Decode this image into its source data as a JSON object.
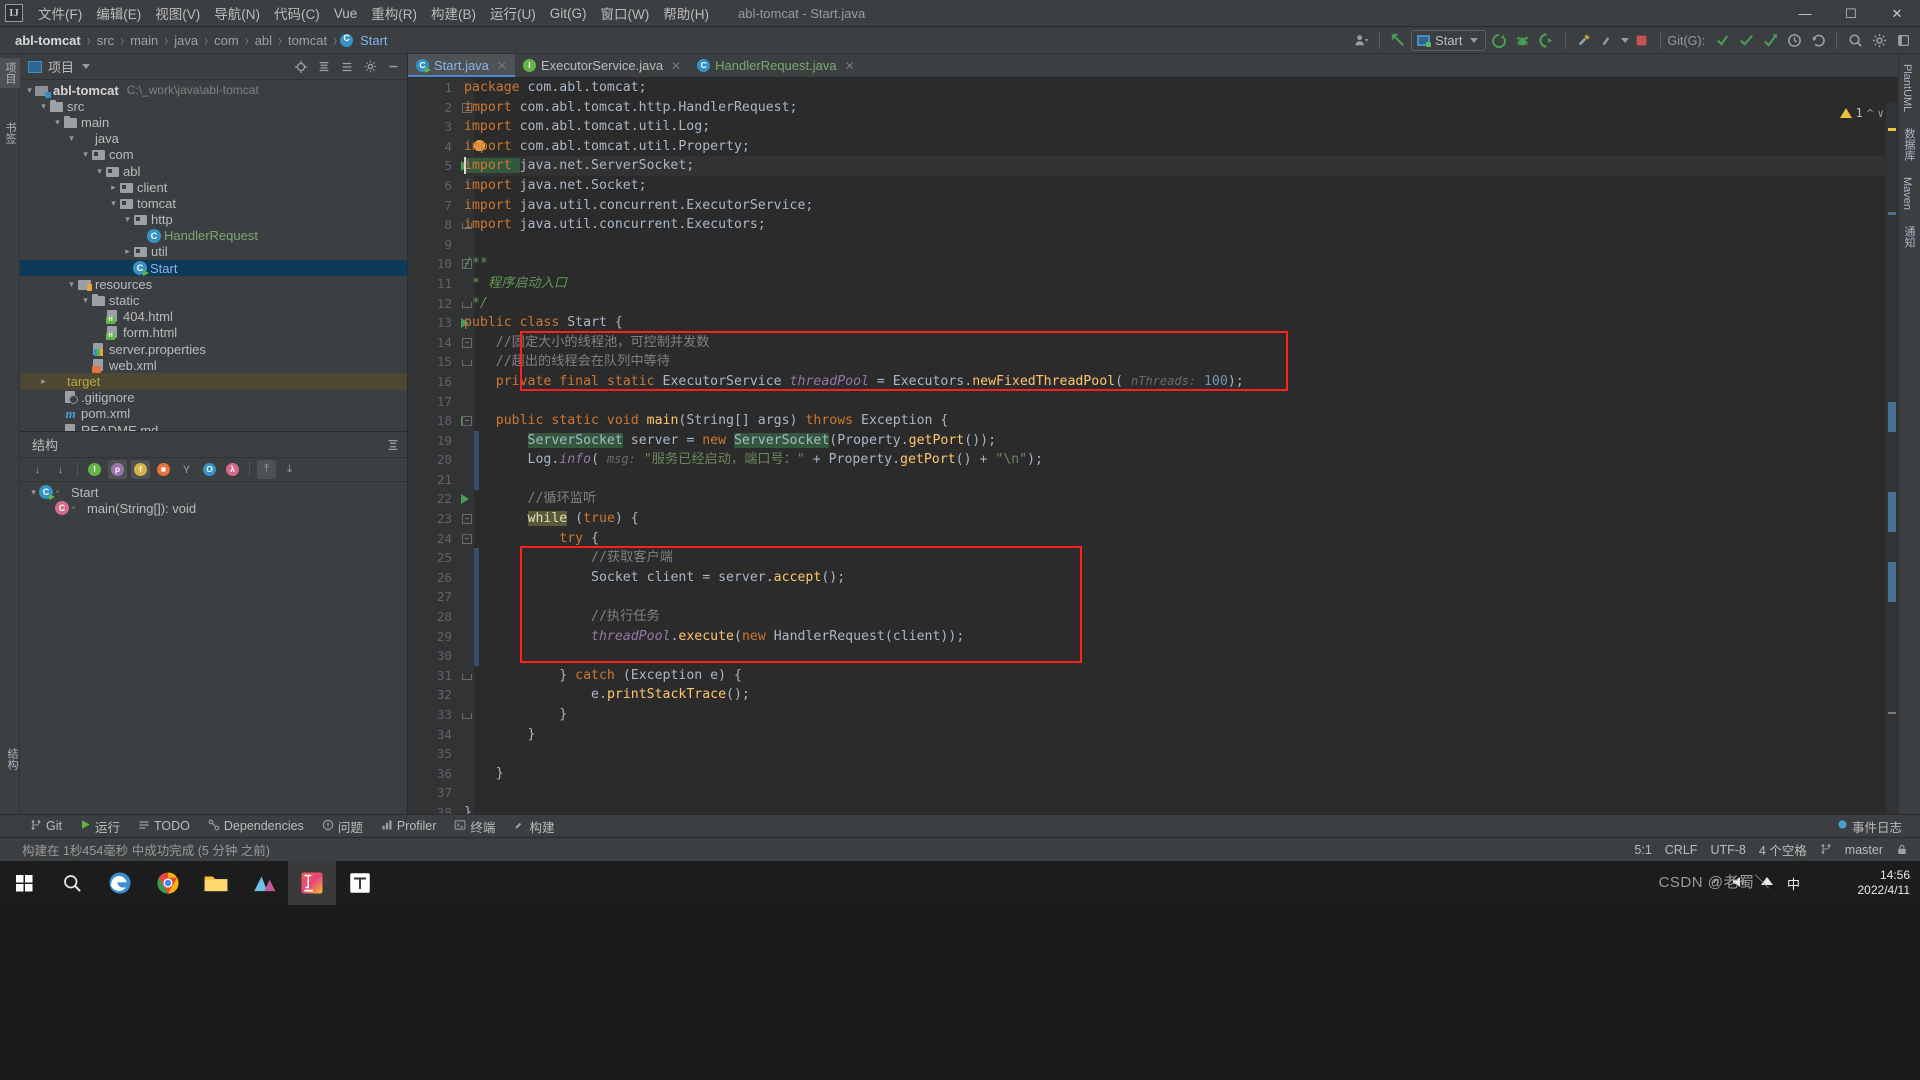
{
  "window": {
    "title": "abl-tomcat - Start.java",
    "controls": {
      "minimize": "—",
      "maximize": "☐",
      "close": "✕"
    }
  },
  "menu": {
    "items": [
      {
        "label": "文件(F)"
      },
      {
        "label": "编辑(E)"
      },
      {
        "label": "视图(V)"
      },
      {
        "label": "导航(N)"
      },
      {
        "label": "代码(C)"
      },
      {
        "label": "Vue"
      },
      {
        "label": "重构(R)"
      },
      {
        "label": "构建(B)"
      },
      {
        "label": "运行(U)"
      },
      {
        "label": "Git(G)"
      },
      {
        "label": "窗口(W)"
      },
      {
        "label": "帮助(H)"
      }
    ]
  },
  "breadcrumb": {
    "items": [
      "abl-tomcat",
      "src",
      "main",
      "java",
      "com",
      "abl",
      "tomcat",
      "Start"
    ],
    "separator": "›"
  },
  "toolbar": {
    "run_config": "Start",
    "git_label": "Git(G):",
    "profile_icon": "profile-icon",
    "back_icon": "back-arrow-icon",
    "rerun_icon": "rerun-icon",
    "debug_icon": "debug-icon",
    "run_with_coverage_icon": "run-coverage-icon",
    "build_icon": "build-icon",
    "stop_icon": "stop-icon",
    "update_project_icon": "update-project-icon",
    "commit_icon": "commit-icon",
    "push_icon": "push-icon",
    "history_icon": "history-icon",
    "rollback_icon": "rollback-icon",
    "search_icon": "search-everywhere-icon",
    "settings_icon": "settings-icon",
    "minimize_panel_icon": "minimize-icon"
  },
  "project_panel": {
    "title": "项目",
    "tools": [
      "locate-icon",
      "collapse-all-icon",
      "expand-icon",
      "settings-icon",
      "hide-icon"
    ],
    "tree": [
      {
        "depth": 0,
        "arrow": "⌄",
        "icon": "module",
        "label": "abl-tomcat",
        "path": "C:\\_work\\java\\abl-tomcat",
        "style": "root"
      },
      {
        "depth": 1,
        "arrow": "⌄",
        "icon": "folder",
        "label": "src",
        "path": "",
        "style": ""
      },
      {
        "depth": 2,
        "arrow": "⌄",
        "icon": "folder",
        "label": "main",
        "path": "",
        "style": ""
      },
      {
        "depth": 3,
        "arrow": "⌄",
        "icon": "folder-blue",
        "label": "java",
        "path": "",
        "style": ""
      },
      {
        "depth": 4,
        "arrow": "⌄",
        "icon": "package",
        "label": "com",
        "path": "",
        "style": ""
      },
      {
        "depth": 5,
        "arrow": "⌄",
        "icon": "package",
        "label": "abl",
        "path": "",
        "style": ""
      },
      {
        "depth": 6,
        "arrow": "›",
        "icon": "package",
        "label": "client",
        "path": "",
        "style": ""
      },
      {
        "depth": 6,
        "arrow": "⌄",
        "icon": "package",
        "label": "tomcat",
        "path": "",
        "style": ""
      },
      {
        "depth": 7,
        "arrow": "⌄",
        "icon": "package",
        "label": "http",
        "path": "",
        "style": ""
      },
      {
        "depth": 8,
        "arrow": "",
        "icon": "class",
        "label": "HandlerRequest",
        "path": "",
        "style": "green"
      },
      {
        "depth": 7,
        "arrow": "›",
        "icon": "package",
        "label": "util",
        "path": "",
        "style": ""
      },
      {
        "depth": 7,
        "arrow": "",
        "icon": "class-run",
        "label": "Start",
        "path": "",
        "style": "selected"
      },
      {
        "depth": 3,
        "arrow": "⌄",
        "icon": "resources",
        "label": "resources",
        "path": "",
        "style": ""
      },
      {
        "depth": 4,
        "arrow": "⌄",
        "icon": "folder",
        "label": "static",
        "path": "",
        "style": ""
      },
      {
        "depth": 5,
        "arrow": "",
        "icon": "html",
        "label": "404.html",
        "path": "",
        "style": ""
      },
      {
        "depth": 5,
        "arrow": "",
        "icon": "html",
        "label": "form.html",
        "path": "",
        "style": ""
      },
      {
        "depth": 4,
        "arrow": "",
        "icon": "properties",
        "label": "server.properties",
        "path": "",
        "style": ""
      },
      {
        "depth": 4,
        "arrow": "",
        "icon": "xml",
        "label": "web.xml",
        "path": "",
        "style": ""
      },
      {
        "depth": 1,
        "arrow": "›",
        "icon": "folder-orange",
        "label": "target",
        "path": "",
        "style": "target"
      },
      {
        "depth": 2,
        "arrow": "",
        "icon": "gitignore",
        "label": ".gitignore",
        "path": "",
        "style": ""
      },
      {
        "depth": 2,
        "arrow": "",
        "icon": "maven",
        "label": "pom.xml",
        "path": "",
        "style": ""
      },
      {
        "depth": 2,
        "arrow": "",
        "icon": "markdown",
        "label": "README.md",
        "path": "",
        "style": ""
      }
    ]
  },
  "structure_panel": {
    "title": "结构",
    "tools": [
      {
        "name": "sort-by-visibility-icon",
        "glyph": "↓",
        "badge": "",
        "on": false
      },
      {
        "name": "sort-alphabetically-icon",
        "glyph": "↓",
        "badge": "",
        "on": false
      },
      {
        "name": "show-inherited-icon",
        "glyph": "I",
        "badge": "#62b543",
        "on": false
      },
      {
        "name": "show-properties-icon",
        "glyph": "p",
        "badge": "#9876aa",
        "on": true
      },
      {
        "name": "show-fields-icon",
        "glyph": "f",
        "badge": "#d9b24a",
        "on": true
      },
      {
        "name": "show-non-public-icon",
        "glyph": "■",
        "badge": "#e8733d",
        "on": false
      },
      {
        "name": "show-anonymous-icon",
        "glyph": "Y",
        "badge": "",
        "on": false
      },
      {
        "name": "show-interfaces-icon",
        "glyph": "O",
        "badge": "#3592c4",
        "on": false
      },
      {
        "name": "show-lambdas-icon",
        "glyph": "λ",
        "badge": "#d46a8a",
        "on": false
      },
      {
        "name": "expand-all-icon",
        "glyph": "⤒",
        "badge": "",
        "on": true
      },
      {
        "name": "collapse-all-icon",
        "glyph": "⤓",
        "badge": "",
        "on": false
      }
    ],
    "tree": [
      {
        "depth": 0,
        "arrow": "⌄",
        "kind": "class",
        "label": "Start"
      },
      {
        "depth": 1,
        "arrow": "",
        "kind": "method",
        "label": "main(String[]): void"
      }
    ]
  },
  "editor": {
    "tabs": [
      {
        "label": "Start.java",
        "icon": "class-run",
        "active": true,
        "color": "blue"
      },
      {
        "label": "ExecutorService.java",
        "icon": "interface",
        "active": false,
        "color": "plain"
      },
      {
        "label": "HandlerRequest.java",
        "icon": "class",
        "active": false,
        "color": "green"
      }
    ],
    "warning_count": "1",
    "caret_position": "5:1",
    "lines": [
      {
        "n": "1",
        "tokens": [
          {
            "t": "package ",
            "c": "kw"
          },
          {
            "t": "com.abl.tomcat;",
            "c": "pln"
          }
        ]
      },
      {
        "n": "2",
        "fold": "minus",
        "tokens": [
          {
            "t": "import ",
            "c": "kw"
          },
          {
            "t": "com.abl.tomcat.http.HandlerRequest;",
            "c": "pln"
          }
        ]
      },
      {
        "n": "3",
        "tokens": [
          {
            "t": "import ",
            "c": "kw"
          },
          {
            "t": "com.abl.tomcat.util.Log;",
            "c": "pln"
          }
        ]
      },
      {
        "n": "4",
        "bulb": true,
        "tokens": [
          {
            "t": "import ",
            "c": "kw"
          },
          {
            "t": "com.abl.tomcat.util.Property;",
            "c": "pln"
          }
        ]
      },
      {
        "n": "5",
        "caret": true,
        "run": true,
        "tokens": [
          {
            "t": "import ",
            "c": "kw warnbg"
          },
          {
            "t": "java.net.ServerSocket;",
            "c": "pln"
          }
        ]
      },
      {
        "n": "6",
        "tokens": [
          {
            "t": "import ",
            "c": "kw"
          },
          {
            "t": "java.net.Socket;",
            "c": "pln"
          }
        ]
      },
      {
        "n": "7",
        "tokens": [
          {
            "t": "import ",
            "c": "kw"
          },
          {
            "t": "java.util.concurrent.ExecutorService;",
            "c": "pln"
          }
        ]
      },
      {
        "n": "8",
        "fold": "end",
        "tokens": [
          {
            "t": "import ",
            "c": "kw"
          },
          {
            "t": "java.util.concurrent.Executors;",
            "c": "pln"
          }
        ]
      },
      {
        "n": "9",
        "tokens": []
      },
      {
        "n": "10",
        "fold": "minus",
        "tokens": [
          {
            "t": "/**",
            "c": "doc"
          }
        ]
      },
      {
        "n": "11",
        "tokens": [
          {
            "t": " * 程序启动入口",
            "c": "doc"
          }
        ]
      },
      {
        "n": "12",
        "fold": "end",
        "tokens": [
          {
            "t": " */",
            "c": "doc"
          }
        ]
      },
      {
        "n": "13",
        "run": true,
        "tokens": [
          {
            "t": "public ",
            "c": "kw"
          },
          {
            "t": "class ",
            "c": "kw"
          },
          {
            "t": "Start {",
            "c": "pln"
          }
        ]
      },
      {
        "n": "14",
        "fold": "minus",
        "indent": 1,
        "tokens": [
          {
            "t": "//固定大小的线程池，可控制并发数",
            "c": "cmt"
          }
        ]
      },
      {
        "n": "15",
        "fold": "end",
        "indent": 1,
        "tokens": [
          {
            "t": "//超出的线程会在队列中等待",
            "c": "cmt"
          }
        ]
      },
      {
        "n": "16",
        "indent": 1,
        "tokens": [
          {
            "t": "private ",
            "c": "kw"
          },
          {
            "t": "final ",
            "c": "kw"
          },
          {
            "t": "static ",
            "c": "kw"
          },
          {
            "t": "ExecutorService ",
            "c": "pln"
          },
          {
            "t": "threadPool",
            "c": "fld"
          },
          {
            "t": " = Executors.",
            "c": "pln"
          },
          {
            "t": "newFixedThreadPool",
            "c": "mth"
          },
          {
            "t": "( ",
            "c": "pln"
          },
          {
            "t": "nThreads:",
            "c": "hint"
          },
          {
            "t": " ",
            "c": "pln"
          },
          {
            "t": "100",
            "c": "num"
          },
          {
            "t": ");",
            "c": "pln"
          }
        ]
      },
      {
        "n": "17",
        "tokens": []
      },
      {
        "n": "18",
        "run": true,
        "fold": "minus",
        "indent": 1,
        "tokens": [
          {
            "t": "public ",
            "c": "kw"
          },
          {
            "t": "static ",
            "c": "kw"
          },
          {
            "t": "void ",
            "c": "kw"
          },
          {
            "t": "main",
            "c": "mth"
          },
          {
            "t": "(String[] args) ",
            "c": "pln"
          },
          {
            "t": "throws ",
            "c": "kw"
          },
          {
            "t": "Exception {",
            "c": "pln"
          }
        ]
      },
      {
        "n": "19",
        "indent": 2,
        "tokens": [
          {
            "t": "ServerSocket",
            "c": "pln warnbg"
          },
          {
            "t": " server = ",
            "c": "pln"
          },
          {
            "t": "new ",
            "c": "kw"
          },
          {
            "t": "ServerSocket",
            "c": "pln warnbg"
          },
          {
            "t": "(Property.",
            "c": "pln"
          },
          {
            "t": "getPort",
            "c": "mth"
          },
          {
            "t": "());",
            "c": "pln"
          }
        ]
      },
      {
        "n": "20",
        "indent": 2,
        "tokens": [
          {
            "t": "Log.",
            "c": "pln"
          },
          {
            "t": "info",
            "c": "fld"
          },
          {
            "t": "( ",
            "c": "pln"
          },
          {
            "t": "msg:",
            "c": "hint"
          },
          {
            "t": " ",
            "c": "pln"
          },
          {
            "t": "\"服务已经启动，端口号：\"",
            "c": "str"
          },
          {
            "t": " + Property.",
            "c": "pln"
          },
          {
            "t": "getPort",
            "c": "mth"
          },
          {
            "t": "() + ",
            "c": "pln"
          },
          {
            "t": "\"\\n\"",
            "c": "str"
          },
          {
            "t": ");",
            "c": "pln"
          }
        ]
      },
      {
        "n": "21",
        "tokens": []
      },
      {
        "n": "22",
        "run": true,
        "indent": 2,
        "tokens": [
          {
            "t": "//循环监听",
            "c": "cmt"
          }
        ]
      },
      {
        "n": "23",
        "fold": "minus",
        "indent": 2,
        "tokens": [
          {
            "t": "while",
            "c": "kw srchbg"
          },
          {
            "t": " (",
            "c": "pln"
          },
          {
            "t": "true",
            "c": "kw"
          },
          {
            "t": ") {",
            "c": "pln"
          }
        ]
      },
      {
        "n": "24",
        "fold": "minus",
        "indent": 3,
        "tokens": [
          {
            "t": "try ",
            "c": "kw"
          },
          {
            "t": "{",
            "c": "pln"
          }
        ]
      },
      {
        "n": "25",
        "indent": 4,
        "tokens": [
          {
            "t": "//获取客户端",
            "c": "cmt"
          }
        ]
      },
      {
        "n": "26",
        "indent": 4,
        "tokens": [
          {
            "t": "Socket client = server.",
            "c": "pln"
          },
          {
            "t": "accept",
            "c": "mth"
          },
          {
            "t": "();",
            "c": "pln"
          }
        ]
      },
      {
        "n": "27",
        "tokens": []
      },
      {
        "n": "28",
        "indent": 4,
        "tokens": [
          {
            "t": "//执行任务",
            "c": "cmt"
          }
        ]
      },
      {
        "n": "29",
        "indent": 4,
        "tokens": [
          {
            "t": "threadPool",
            "c": "fld"
          },
          {
            "t": ".",
            "c": "pln"
          },
          {
            "t": "execute",
            "c": "mth"
          },
          {
            "t": "(",
            "c": "pln"
          },
          {
            "t": "new ",
            "c": "kw"
          },
          {
            "t": "HandlerRequest(client));",
            "c": "pln"
          }
        ]
      },
      {
        "n": "30",
        "tokens": []
      },
      {
        "n": "31",
        "fold": "end",
        "indent": 3,
        "tokens": [
          {
            "t": "} ",
            "c": "pln"
          },
          {
            "t": "catch ",
            "c": "kw"
          },
          {
            "t": "(Exception e) {",
            "c": "pln"
          }
        ]
      },
      {
        "n": "32",
        "indent": 4,
        "tokens": [
          {
            "t": "e.",
            "c": "pln"
          },
          {
            "t": "printStackTrace",
            "c": "mth"
          },
          {
            "t": "();",
            "c": "pln"
          }
        ]
      },
      {
        "n": "33",
        "fold": "end",
        "indent": 3,
        "tokens": [
          {
            "t": "}",
            "c": "pln"
          }
        ]
      },
      {
        "n": "34",
        "indent": 2,
        "tokens": [
          {
            "t": "}",
            "c": "pln"
          }
        ]
      },
      {
        "n": "35",
        "tokens": []
      },
      {
        "n": "36",
        "indent": 1,
        "tokens": [
          {
            "t": "}",
            "c": "pln"
          }
        ]
      },
      {
        "n": "37",
        "tokens": []
      },
      {
        "n": "38",
        "tokens": [
          {
            "t": "}",
            "c": "pln"
          }
        ]
      }
    ]
  },
  "bottom_bar": {
    "items": [
      {
        "label": "Git",
        "icon": "git-icon"
      },
      {
        "label": "运行",
        "icon": "run-icon"
      },
      {
        "label": "TODO",
        "icon": "todo-icon"
      },
      {
        "label": "Dependencies",
        "icon": "dependencies-icon"
      },
      {
        "label": "问题",
        "icon": "problems-icon"
      },
      {
        "label": "Profiler",
        "icon": "profiler-icon"
      },
      {
        "label": "终端",
        "icon": "terminal-icon"
      },
      {
        "label": "构建",
        "icon": "build-icon"
      }
    ],
    "event_log": "事件日志"
  },
  "status_bar": {
    "build_message": "构建在 1秒454毫秒 中成功完成 (5 分钟 之前)",
    "caret": "5:1",
    "line_separator": "CRLF",
    "encoding": "UTF-8",
    "indent": "4 个空格",
    "branch": "master",
    "lock_icon": "lock-icon",
    "notification_icon": "notification-icon"
  },
  "right_strip": {
    "items": [
      "PlantUML",
      "数据库",
      "Maven",
      "通知"
    ]
  },
  "left_strip": {
    "items": [
      "项目",
      "书签",
      "结构"
    ]
  },
  "taskbar": {
    "time": "14:56",
    "date": "2022/4/11",
    "watermark": "CSDN @老蜀＼",
    "apps": [
      "start-menu",
      "search-icon",
      "edge-icon",
      "chrome-icon",
      "explorer-icon",
      "app-icon",
      "idea-icon",
      "typora-icon"
    ],
    "tray": [
      "chevron-up-icon",
      "volume-icon",
      "network-icon",
      "ime-icon"
    ]
  },
  "colors": {
    "accent": "#4a88c7",
    "highlight_box": "#ff2020",
    "selected_row": "#0d3a58",
    "editor_bg": "#2b2b2b",
    "panel_bg": "#3c3f41"
  }
}
